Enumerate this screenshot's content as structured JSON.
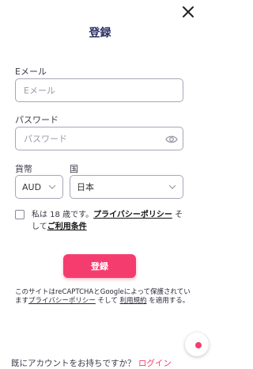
{
  "form": {
    "title": "登録",
    "email_label": "Eメール",
    "email_placeholder": "Eメール",
    "password_label": "パスワード",
    "password_placeholder": "パスワード",
    "currency_label": "貨幣",
    "currency_value": "AUD",
    "country_label": "国",
    "country_value": "日本",
    "terms_prefix": "私は 18 歳です。",
    "terms_privacy_link": "プライバシーポリシー",
    "terms_middle": " そして",
    "terms_conditions_link": "ご利用条件",
    "submit_label": "登録"
  },
  "recaptcha": {
    "prefix": "このサイトはreCAPTCHAとGoogleによって保護されています",
    "privacy_link": "プライバシーポリシー",
    "middle": " そして ",
    "terms_link": "利用規約",
    "suffix": " を適用する。"
  },
  "footer": {
    "prompt": "既にアカウントをお持ちですか？",
    "login_link": "ログイン"
  },
  "colors": {
    "accent": "#f43d6e",
    "title": "#2c2f66"
  },
  "icons": [
    "close-icon",
    "eye-icon",
    "chevron-down-icon"
  ]
}
